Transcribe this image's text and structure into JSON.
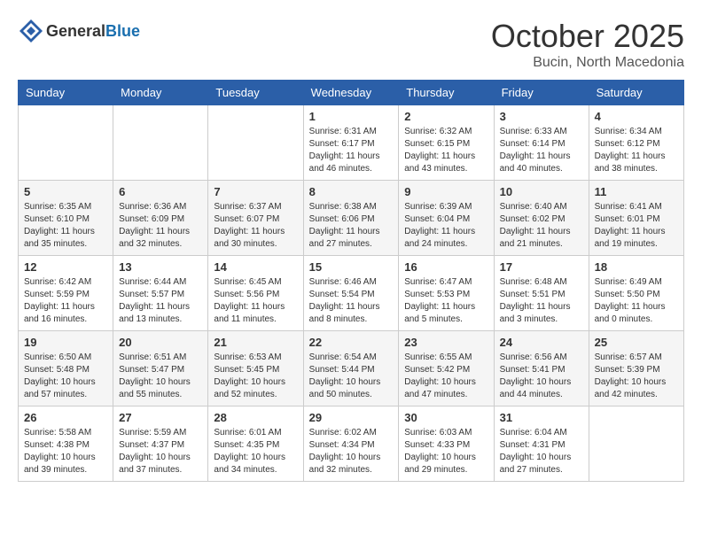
{
  "header": {
    "logo_general": "General",
    "logo_blue": "Blue",
    "month": "October 2025",
    "location": "Bucin, North Macedonia"
  },
  "weekdays": [
    "Sunday",
    "Monday",
    "Tuesday",
    "Wednesday",
    "Thursday",
    "Friday",
    "Saturday"
  ],
  "weeks": [
    [
      {
        "day": "",
        "info": ""
      },
      {
        "day": "",
        "info": ""
      },
      {
        "day": "",
        "info": ""
      },
      {
        "day": "1",
        "info": "Sunrise: 6:31 AM\nSunset: 6:17 PM\nDaylight: 11 hours\nand 46 minutes."
      },
      {
        "day": "2",
        "info": "Sunrise: 6:32 AM\nSunset: 6:15 PM\nDaylight: 11 hours\nand 43 minutes."
      },
      {
        "day": "3",
        "info": "Sunrise: 6:33 AM\nSunset: 6:14 PM\nDaylight: 11 hours\nand 40 minutes."
      },
      {
        "day": "4",
        "info": "Sunrise: 6:34 AM\nSunset: 6:12 PM\nDaylight: 11 hours\nand 38 minutes."
      }
    ],
    [
      {
        "day": "5",
        "info": "Sunrise: 6:35 AM\nSunset: 6:10 PM\nDaylight: 11 hours\nand 35 minutes."
      },
      {
        "day": "6",
        "info": "Sunrise: 6:36 AM\nSunset: 6:09 PM\nDaylight: 11 hours\nand 32 minutes."
      },
      {
        "day": "7",
        "info": "Sunrise: 6:37 AM\nSunset: 6:07 PM\nDaylight: 11 hours\nand 30 minutes."
      },
      {
        "day": "8",
        "info": "Sunrise: 6:38 AM\nSunset: 6:06 PM\nDaylight: 11 hours\nand 27 minutes."
      },
      {
        "day": "9",
        "info": "Sunrise: 6:39 AM\nSunset: 6:04 PM\nDaylight: 11 hours\nand 24 minutes."
      },
      {
        "day": "10",
        "info": "Sunrise: 6:40 AM\nSunset: 6:02 PM\nDaylight: 11 hours\nand 21 minutes."
      },
      {
        "day": "11",
        "info": "Sunrise: 6:41 AM\nSunset: 6:01 PM\nDaylight: 11 hours\nand 19 minutes."
      }
    ],
    [
      {
        "day": "12",
        "info": "Sunrise: 6:42 AM\nSunset: 5:59 PM\nDaylight: 11 hours\nand 16 minutes."
      },
      {
        "day": "13",
        "info": "Sunrise: 6:44 AM\nSunset: 5:57 PM\nDaylight: 11 hours\nand 13 minutes."
      },
      {
        "day": "14",
        "info": "Sunrise: 6:45 AM\nSunset: 5:56 PM\nDaylight: 11 hours\nand 11 minutes."
      },
      {
        "day": "15",
        "info": "Sunrise: 6:46 AM\nSunset: 5:54 PM\nDaylight: 11 hours\nand 8 minutes."
      },
      {
        "day": "16",
        "info": "Sunrise: 6:47 AM\nSunset: 5:53 PM\nDaylight: 11 hours\nand 5 minutes."
      },
      {
        "day": "17",
        "info": "Sunrise: 6:48 AM\nSunset: 5:51 PM\nDaylight: 11 hours\nand 3 minutes."
      },
      {
        "day": "18",
        "info": "Sunrise: 6:49 AM\nSunset: 5:50 PM\nDaylight: 11 hours\nand 0 minutes."
      }
    ],
    [
      {
        "day": "19",
        "info": "Sunrise: 6:50 AM\nSunset: 5:48 PM\nDaylight: 10 hours\nand 57 minutes."
      },
      {
        "day": "20",
        "info": "Sunrise: 6:51 AM\nSunset: 5:47 PM\nDaylight: 10 hours\nand 55 minutes."
      },
      {
        "day": "21",
        "info": "Sunrise: 6:53 AM\nSunset: 5:45 PM\nDaylight: 10 hours\nand 52 minutes."
      },
      {
        "day": "22",
        "info": "Sunrise: 6:54 AM\nSunset: 5:44 PM\nDaylight: 10 hours\nand 50 minutes."
      },
      {
        "day": "23",
        "info": "Sunrise: 6:55 AM\nSunset: 5:42 PM\nDaylight: 10 hours\nand 47 minutes."
      },
      {
        "day": "24",
        "info": "Sunrise: 6:56 AM\nSunset: 5:41 PM\nDaylight: 10 hours\nand 44 minutes."
      },
      {
        "day": "25",
        "info": "Sunrise: 6:57 AM\nSunset: 5:39 PM\nDaylight: 10 hours\nand 42 minutes."
      }
    ],
    [
      {
        "day": "26",
        "info": "Sunrise: 5:58 AM\nSunset: 4:38 PM\nDaylight: 10 hours\nand 39 minutes."
      },
      {
        "day": "27",
        "info": "Sunrise: 5:59 AM\nSunset: 4:37 PM\nDaylight: 10 hours\nand 37 minutes."
      },
      {
        "day": "28",
        "info": "Sunrise: 6:01 AM\nSunset: 4:35 PM\nDaylight: 10 hours\nand 34 minutes."
      },
      {
        "day": "29",
        "info": "Sunrise: 6:02 AM\nSunset: 4:34 PM\nDaylight: 10 hours\nand 32 minutes."
      },
      {
        "day": "30",
        "info": "Sunrise: 6:03 AM\nSunset: 4:33 PM\nDaylight: 10 hours\nand 29 minutes."
      },
      {
        "day": "31",
        "info": "Sunrise: 6:04 AM\nSunset: 4:31 PM\nDaylight: 10 hours\nand 27 minutes."
      },
      {
        "day": "",
        "info": ""
      }
    ]
  ]
}
